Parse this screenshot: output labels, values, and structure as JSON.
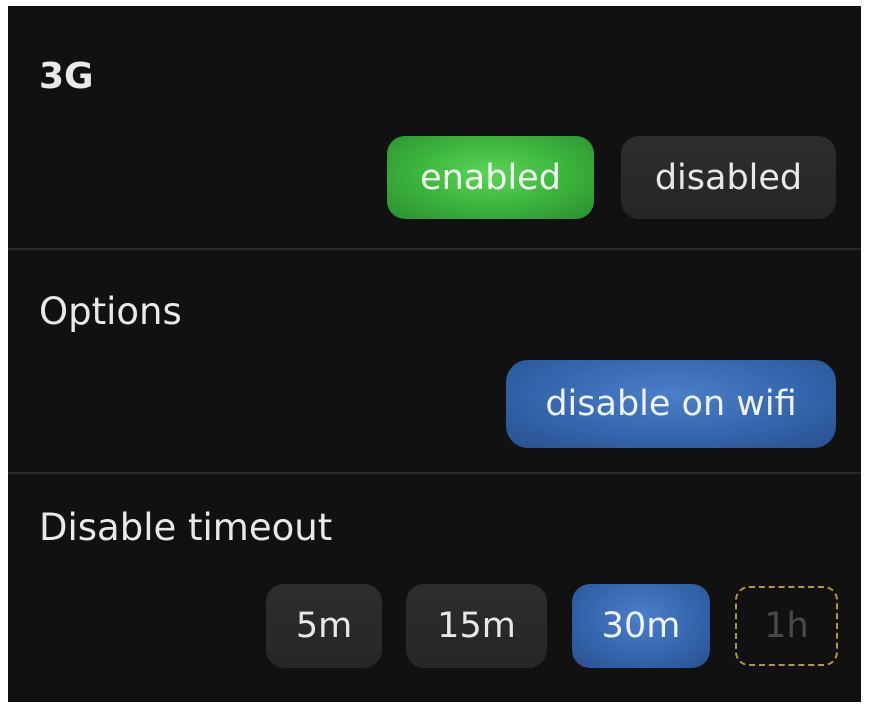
{
  "sections": {
    "network": {
      "title": "3G",
      "options": [
        {
          "label": "enabled",
          "selected": true
        },
        {
          "label": "disabled",
          "selected": false
        }
      ]
    },
    "options": {
      "title": "Options",
      "toggle_label": "disable on wifi",
      "toggle_on": true
    },
    "timeout": {
      "title": "Disable timeout",
      "options": [
        {
          "label": "5m",
          "selected": false
        },
        {
          "label": "15m",
          "selected": false
        },
        {
          "label": "30m",
          "selected": true
        },
        {
          "label": "1h",
          "selected": false,
          "focused": true
        }
      ]
    }
  },
  "colors": {
    "background": "#111111",
    "enabled_green": "#3fb93f",
    "selected_blue": "#3566ad",
    "unselected_gray": "#2a2a2a",
    "focus_outline": "#b8963e"
  }
}
